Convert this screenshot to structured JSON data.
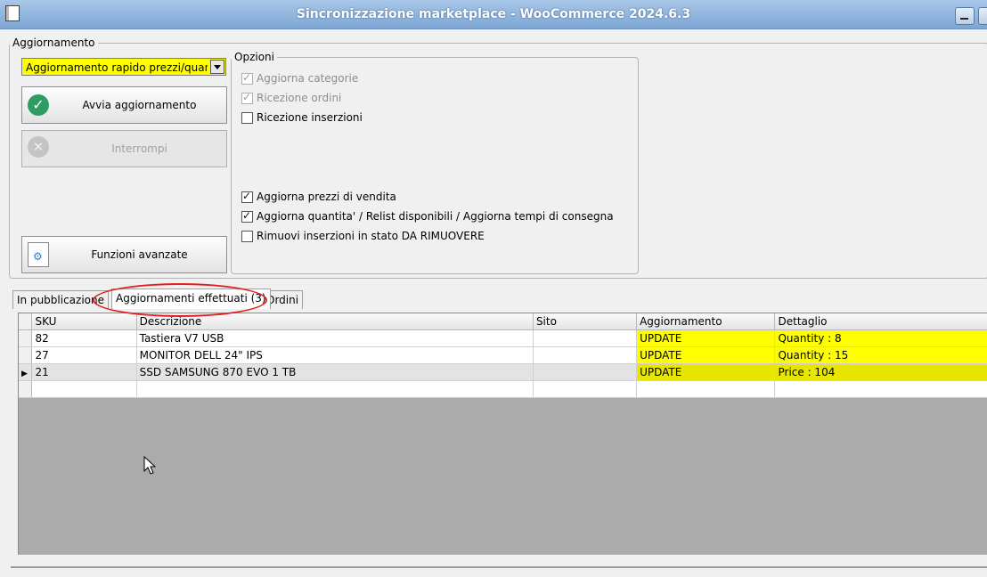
{
  "window": {
    "title": "Sincronizzazione marketplace - WooCommerce 2024.6.3"
  },
  "aggiornamento": {
    "legend": "Aggiornamento",
    "mode_value": "Aggiornamento rapido prezzi/quantit",
    "start_button": "Avvia aggiornamento",
    "stop_button": "Interrompi",
    "advanced_button": "Funzioni avanzate"
  },
  "opzioni": {
    "legend": "Opzioni",
    "items": [
      {
        "label": "Aggiorna categorie",
        "checked": true,
        "enabled": false
      },
      {
        "label": "Ricezione ordini",
        "checked": true,
        "enabled": false
      },
      {
        "label": "Ricezione inserzioni",
        "checked": false,
        "enabled": true
      },
      {
        "label": "Aggiorna prezzi di vendita",
        "checked": true,
        "enabled": true
      },
      {
        "label": "Aggiorna quantita' / Relist disponibili / Aggiorna tempi di consegna",
        "checked": true,
        "enabled": true
      },
      {
        "label": "Rimuovi inserzioni in stato DA RIMUOVERE",
        "checked": false,
        "enabled": true
      }
    ]
  },
  "tabs": [
    {
      "label": "In pubblicazione"
    },
    {
      "label": "Aggiornamenti effettuati (3)",
      "active": true
    },
    {
      "label": "Ordini"
    }
  ],
  "table": {
    "columns": [
      "SKU",
      "Descrizione",
      "Sito",
      "Aggiornamento",
      "Dettaglio"
    ],
    "rows": [
      {
        "sku": "82",
        "descrizione": "Tastiera V7 USB",
        "sito": "",
        "aggiornamento": "UPDATE",
        "dettaglio": "Quantity : 8"
      },
      {
        "sku": "27",
        "descrizione": "MONITOR DELL 24\" IPS",
        "sito": "",
        "aggiornamento": "UPDATE",
        "dettaglio": "Quantity : 15"
      },
      {
        "sku": "21",
        "descrizione": "SSD SAMSUNG 870 EVO 1 TB",
        "sito": "",
        "aggiornamento": "UPDATE",
        "dettaglio": "Price : 104"
      }
    ]
  },
  "colors": {
    "highlight_yellow": "#ffff00",
    "annotation_red": "#e02020",
    "ok_green": "#2f9d62"
  }
}
